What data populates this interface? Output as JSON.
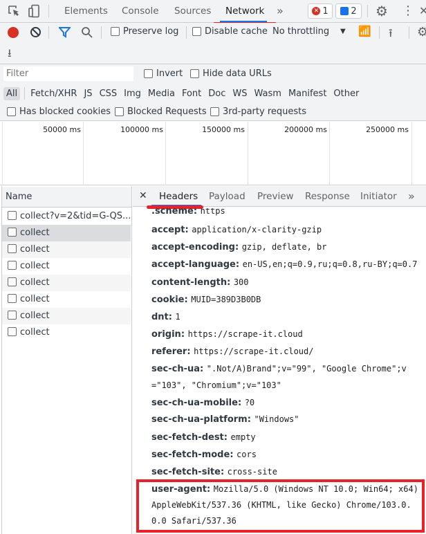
{
  "top_tabs": [
    "Elements",
    "Console",
    "Sources",
    "Network"
  ],
  "active_tab": "Network",
  "more_tabs": "»",
  "errors_count": "1",
  "messages_count": "2",
  "toolbar": {
    "preserve_log": "Preserve log",
    "disable_cache": "Disable cache",
    "throttling": "No throttling"
  },
  "filter": {
    "placeholder": "Filter",
    "invert": "Invert",
    "hide_data_urls": "Hide data URLs"
  },
  "type_filters": [
    "All",
    "Fetch/XHR",
    "JS",
    "CSS",
    "Img",
    "Media",
    "Font",
    "Doc",
    "WS",
    "Wasm",
    "Manifest",
    "Other"
  ],
  "extra_filters": [
    "Has blocked cookies",
    "Blocked Requests",
    "3rd-party requests"
  ],
  "timeline_ticks": [
    "50000 ms",
    "100000 ms",
    "150000 ms",
    "200000 ms",
    "250000 ms"
  ],
  "requests": {
    "header": "Name",
    "items": [
      "collect?v=2&tid=G-QS...",
      "collect",
      "collect",
      "collect",
      "collect",
      "collect",
      "collect",
      "collect"
    ],
    "selected_index": 1
  },
  "details": {
    "tabs": [
      "Headers",
      "Payload",
      "Preview",
      "Response",
      "Initiator"
    ],
    "active_tab": "Headers",
    "headers": [
      {
        "name": ".scheme",
        "value": "https"
      },
      {
        "name": "accept",
        "value": "application/x-clarity-gzip"
      },
      {
        "name": "accept-encoding",
        "value": "gzip, deflate, br"
      },
      {
        "name": "accept-language",
        "value": "en-US,en;q=0.9,ru;q=0.8,ru-BY;q=0.7"
      },
      {
        "name": "content-length",
        "value": "300"
      },
      {
        "name": "cookie",
        "value": "MUID=389D3B0DB"
      },
      {
        "name": "dnt",
        "value": "1"
      },
      {
        "name": "origin",
        "value": "https://scrape-it.cloud"
      },
      {
        "name": "referer",
        "value": "https://scrape-it.cloud/"
      },
      {
        "name": "sec-ch-ua",
        "value": "\".Not/A)Brand\";v=\"99\", \"Google Chrome\";v",
        "value2": "=\"103\", \"Chromium\";v=\"103\""
      },
      {
        "name": "sec-ch-ua-mobile",
        "value": "?0"
      },
      {
        "name": "sec-ch-ua-platform",
        "value": "\"Windows\""
      },
      {
        "name": "sec-fetch-dest",
        "value": "empty"
      },
      {
        "name": "sec-fetch-mode",
        "value": "cors"
      },
      {
        "name": "sec-fetch-site",
        "value": "cross-site"
      },
      {
        "name": "user-agent",
        "value": "Mozilla/5.0 (Windows NT 10.0; Win64; x64)",
        "value2": "AppleWebKit/537.36 (KHTML, like Gecko) Chrome/103.0.",
        "value3": "0.0 Safari/537.36"
      }
    ]
  },
  "colors": {
    "accent": "#1a73e8",
    "annotation_red": "#e8212b",
    "record": "#d93025"
  }
}
